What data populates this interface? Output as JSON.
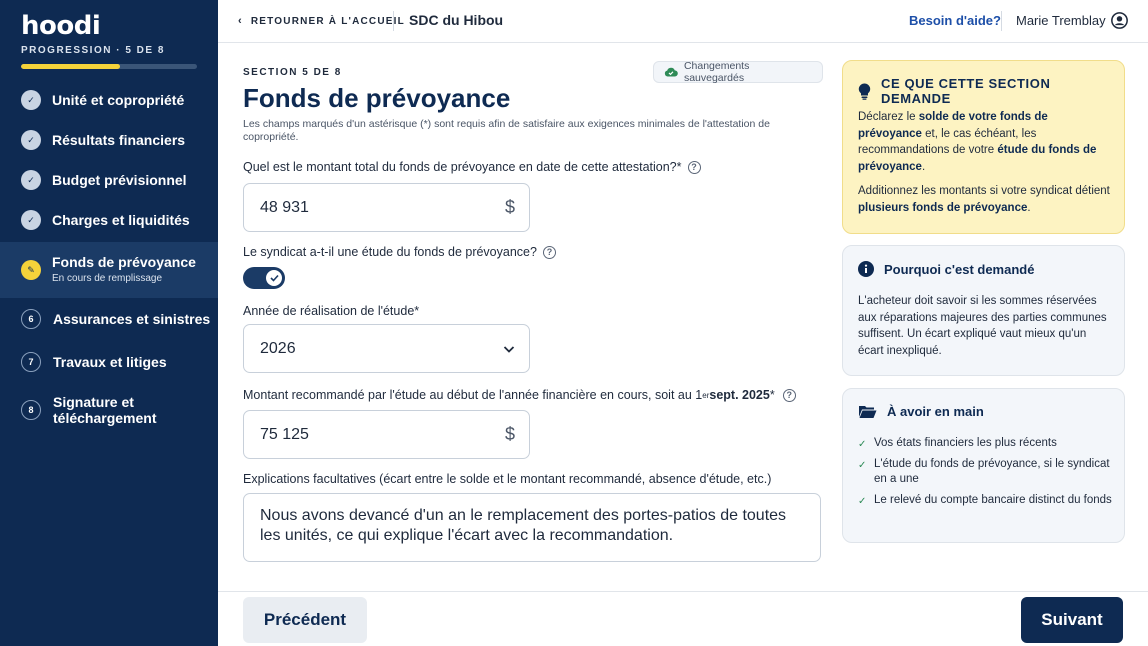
{
  "sidebar": {
    "logo": "hoodi",
    "progress_label": "PROGRESSION · 5 DE 8",
    "progress_value": 0.56,
    "items": [
      {
        "label": "Unité et copropriété",
        "status": "done",
        "marker": "✓"
      },
      {
        "label": "Résultats financiers",
        "status": "done",
        "marker": "✓"
      },
      {
        "label": "Budget prévisionnel",
        "status": "done",
        "marker": "✓"
      },
      {
        "label": "Charges et liquidités",
        "status": "done",
        "marker": "✓"
      },
      {
        "label": "Fonds de prévoyance",
        "sub": "En cours de remplissage",
        "status": "active",
        "marker": "✎"
      },
      {
        "label": "Assurances et sinistres",
        "status": "todo",
        "marker": "6"
      },
      {
        "label": "Travaux et litiges",
        "status": "todo",
        "marker": "7"
      },
      {
        "label_line1": "Signature et",
        "label_line2": "téléchargement",
        "status": "todo",
        "marker": "8"
      }
    ]
  },
  "topbar": {
    "back_label": "RETOURNER À L'ACCUEIL",
    "sdc_name": "SDC du Hibou",
    "help_label": "Besoin d'aide?",
    "user_name": "Marie Tremblay"
  },
  "form": {
    "eyebrow": "SECTION 5 DE 8",
    "saved_label": "Changements sauvegardés",
    "title": "Fonds de prévoyance",
    "intro": "Les champs marqués d'un astérisque (*) sont requis afin de satisfaire aux exigences minimales de l'attestation de copropriété.",
    "q1_label": "Quel est le montant total du fonds de prévoyance en date de cette attestation?*",
    "q1_value": "48 931",
    "currency": "$",
    "q2_label": "Le syndicat a-t-il une étude du fonds de prévoyance?",
    "q2_toggle_on": true,
    "q3_label": "Année de réalisation de l'étude*",
    "q3_value": "2026",
    "q4_label_a": "Montant recommandé par l'étude au début de l'année financière en cours, soit au 1",
    "q4_label_sup": "er",
    "q4_label_b": " sept. 2025",
    "q4_label_c": "*",
    "q4_value": "75 125",
    "q5_label": "Explications facultatives (écart entre le solde et le montant recommandé, absence d'étude, etc.)",
    "q5_value": "Nous avons devancé d'un an le remplacement des portes-patios de toutes les unités, ce qui explique l'écart avec la recommandation."
  },
  "footer": {
    "prev_label": "Précédent",
    "next_label": "Suivant"
  },
  "cards": {
    "what": {
      "title": "CE QUE CETTE SECTION DEMANDE",
      "p1_a": "Déclarez le ",
      "p1_b": "solde de votre fonds de prévoyance",
      "p1_c": " et, le cas échéant, les recommandations de votre ",
      "p1_d": "étude du fonds de prévoyance",
      "p1_e": ".",
      "p2_a": "Additionnez les montants si votre syndicat détient ",
      "p2_b": "plusieurs fonds de prévoyance",
      "p2_c": "."
    },
    "why": {
      "title": "Pourquoi c'est demandé",
      "body": "L'acheteur doit savoir si les sommes réservées aux réparations majeures des parties communes suffisent. Un écart expliqué vaut mieux qu'un écart inexpliqué."
    },
    "have": {
      "title": "À avoir en main",
      "items": [
        "Vos états financiers les plus récents",
        "L'étude du fonds de prévoyance, si le syndicat en a une",
        "Le relevé du compte bancaire distinct du fonds"
      ]
    }
  },
  "colors": {
    "navy": "#0e2a52",
    "accent_yellow": "#f5d33a",
    "link_blue": "#1d4fa8"
  }
}
